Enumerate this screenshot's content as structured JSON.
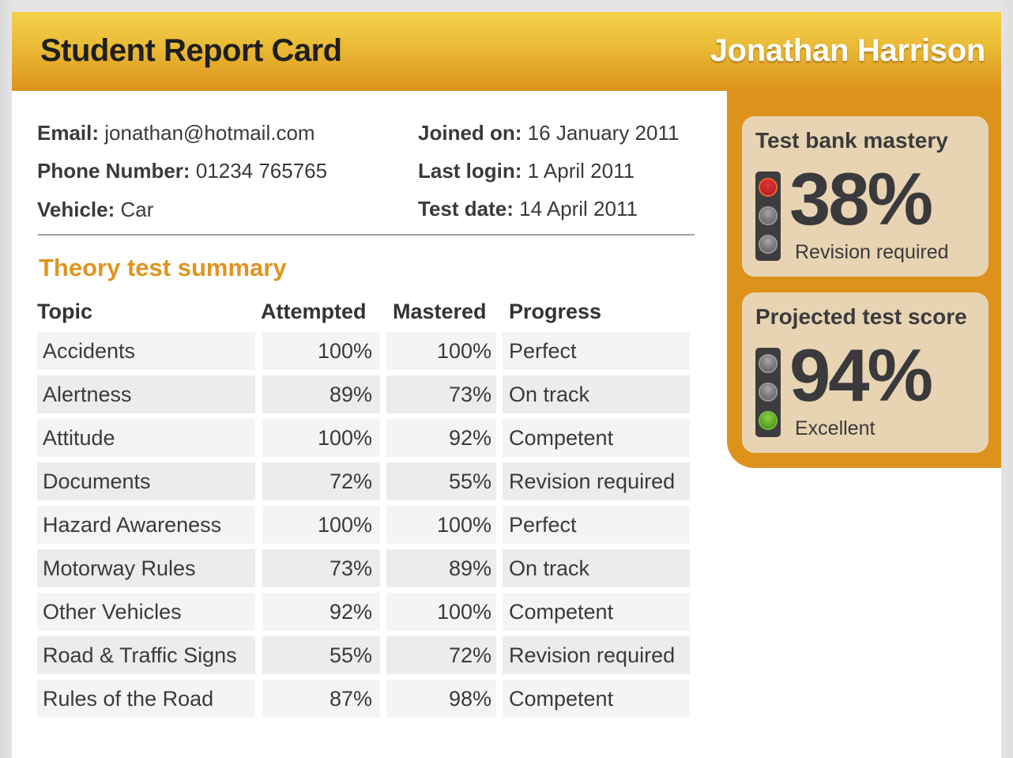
{
  "header": {
    "title": "Student Report Card",
    "student_name": "Jonathan Harrison"
  },
  "profile": {
    "email": {
      "label": "Email:",
      "value": "jonathan@hotmail.com"
    },
    "phone": {
      "label": "Phone Number:",
      "value": "01234 765765"
    },
    "vehicle": {
      "label": "Vehicle:",
      "value": "Car"
    },
    "joined": {
      "label": "Joined on:",
      "value": "16 January 2011"
    },
    "last_login": {
      "label": "Last login:",
      "value": "1 April 2011"
    },
    "test_date": {
      "label": "Test date:",
      "value": "14 April 2011"
    }
  },
  "summary": {
    "title": "Theory test summary",
    "columns": [
      "Topic",
      "Attempted",
      "Mastered",
      "Progress"
    ],
    "rows": [
      {
        "topic": "Accidents",
        "attempted": "100%",
        "mastered": "100%",
        "progress": "Perfect"
      },
      {
        "topic": "Alertness",
        "attempted": "89%",
        "mastered": "73%",
        "progress": "On track"
      },
      {
        "topic": "Attitude",
        "attempted": "100%",
        "mastered": "92%",
        "progress": "Competent"
      },
      {
        "topic": "Documents",
        "attempted": "72%",
        "mastered": "55%",
        "progress": "Revision required"
      },
      {
        "topic": "Hazard Awareness",
        "attempted": "100%",
        "mastered": "100%",
        "progress": "Perfect"
      },
      {
        "topic": "Motorway Rules",
        "attempted": "73%",
        "mastered": "89%",
        "progress": "On track"
      },
      {
        "topic": "Other Vehicles",
        "attempted": "92%",
        "mastered": "100%",
        "progress": "Competent"
      },
      {
        "topic": "Road & Traffic Signs",
        "attempted": "55%",
        "mastered": "72%",
        "progress": "Revision required"
      },
      {
        "topic": "Rules of the Road",
        "attempted": "87%",
        "mastered": "98%",
        "progress": "Competent"
      }
    ]
  },
  "cards": [
    {
      "title": "Test bank mastery",
      "value": "38%",
      "status": "Revision required",
      "light": "red"
    },
    {
      "title": "Projected test score",
      "value": "94%",
      "status": "Excellent",
      "light": "green"
    }
  ],
  "colors": {
    "accent": "#dc921b",
    "header_top": "#f3d149",
    "section_title": "#de951f",
    "card_bg": "#e8d4b2",
    "light_red": "#c0202a",
    "light_green": "#5aa22a"
  }
}
